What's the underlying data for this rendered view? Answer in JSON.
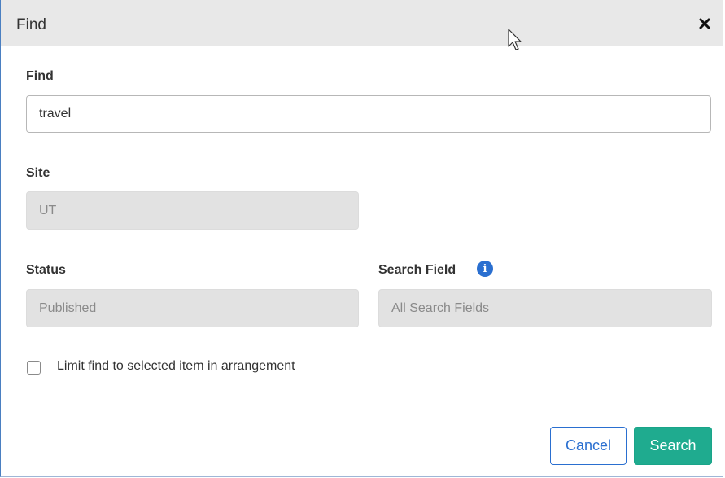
{
  "dialog": {
    "title": "Find",
    "close_icon": "close-icon"
  },
  "find": {
    "label": "Find",
    "value": "travel"
  },
  "site": {
    "label": "Site",
    "value": "UT"
  },
  "status": {
    "label": "Status",
    "value": "Published"
  },
  "search_field": {
    "label": "Search Field",
    "info_icon": "info-icon",
    "info_glyph": "i",
    "value": "All Search Fields"
  },
  "limit_checkbox": {
    "label": "Limit find to selected item in arrangement",
    "checked": false
  },
  "buttons": {
    "cancel": "Cancel",
    "search": "Search"
  },
  "colors": {
    "accent_blue": "#2a6fd0",
    "search_green": "#1fab8f",
    "titlebar_bg": "#e8e8e8",
    "disabled_bg": "#e2e2e2"
  }
}
